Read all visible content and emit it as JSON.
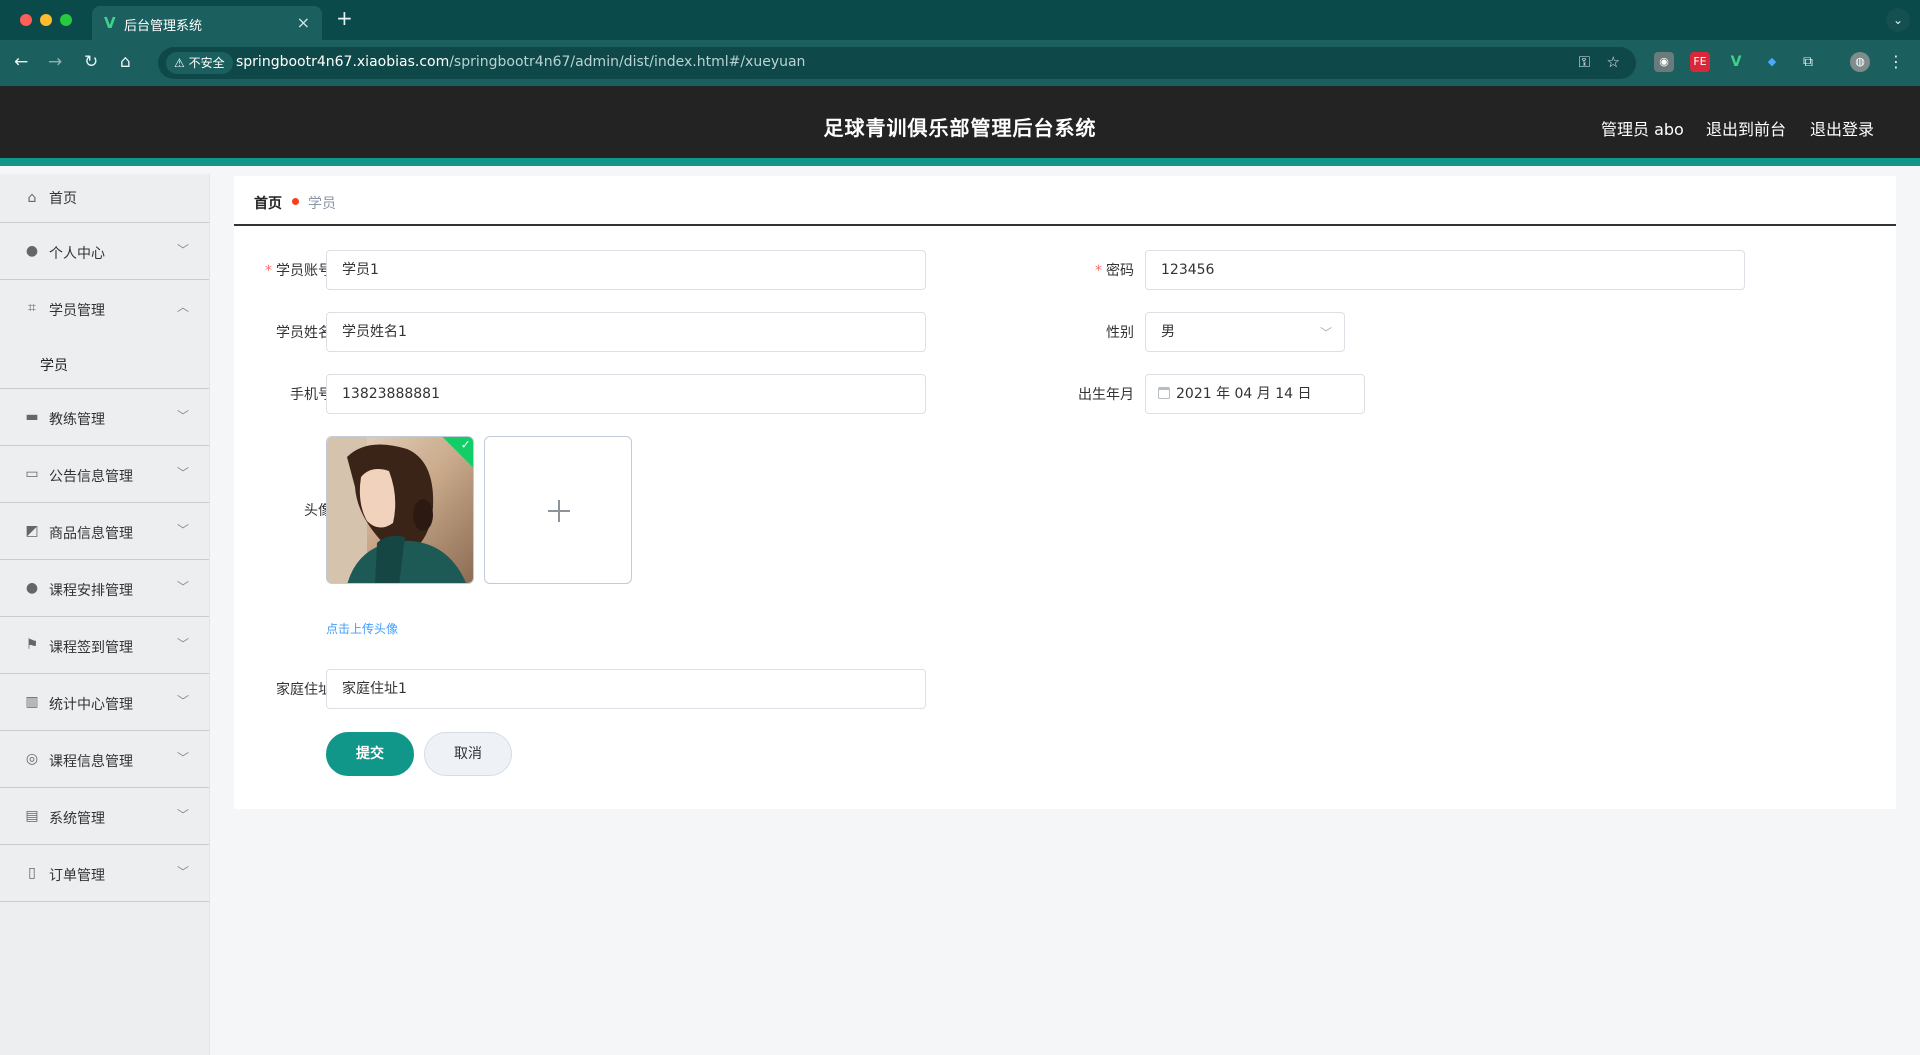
{
  "browser": {
    "tab_title": "后台管理系统",
    "tab_favicon": "V",
    "insecure_label": "不安全",
    "url_host": "springbootr4n67.xiaobias.com",
    "url_path": "/springbootr4n67/admin/dist/index.html#/xueyuan"
  },
  "header": {
    "title": "足球青训俱乐部管理后台系统",
    "user_label": "管理员 abo",
    "to_front": "退出到前台",
    "logout": "退出登录"
  },
  "sidebar": {
    "home": "首页",
    "items": [
      {
        "label": "个人中心",
        "icon": "user-icon"
      },
      {
        "label": "学员管理",
        "icon": "crop-icon",
        "expanded": true
      },
      {
        "label": "教练管理",
        "icon": "briefcase-icon"
      },
      {
        "label": "公告信息管理",
        "icon": "id-card-icon"
      },
      {
        "label": "商品信息管理",
        "icon": "chart-icon"
      },
      {
        "label": "课程安排管理",
        "icon": "user-icon"
      },
      {
        "label": "课程签到管理",
        "icon": "flag-icon"
      },
      {
        "label": "统计中心管理",
        "icon": "bar-chart-icon"
      },
      {
        "label": "课程信息管理",
        "icon": "compass-icon"
      },
      {
        "label": "系统管理",
        "icon": "clipboard-icon"
      },
      {
        "label": "订单管理",
        "icon": "mic-icon"
      }
    ],
    "sub_item": "学员"
  },
  "breadcrumb": {
    "home": "首页",
    "current": "学员"
  },
  "form": {
    "account_label": "学员账号",
    "account_value": "学员1",
    "password_label": "密码",
    "password_value": "123456",
    "name_label": "学员姓名",
    "name_value": "学员姓名1",
    "gender_label": "性别",
    "gender_value": "男",
    "phone_label": "手机号",
    "phone_value": "13823888881",
    "birth_label": "出生年月",
    "birth_value": "2021 年 04 月 14 日",
    "avatar_label": "头像",
    "upload_tip": "点击上传头像",
    "address_label": "家庭住址",
    "address_value": "家庭住址1",
    "submit": "提交",
    "cancel": "取消"
  },
  "colors": {
    "accent": "#11968a",
    "header_bg": "#232323",
    "required": "#f56c6c",
    "link": "#409eff"
  }
}
